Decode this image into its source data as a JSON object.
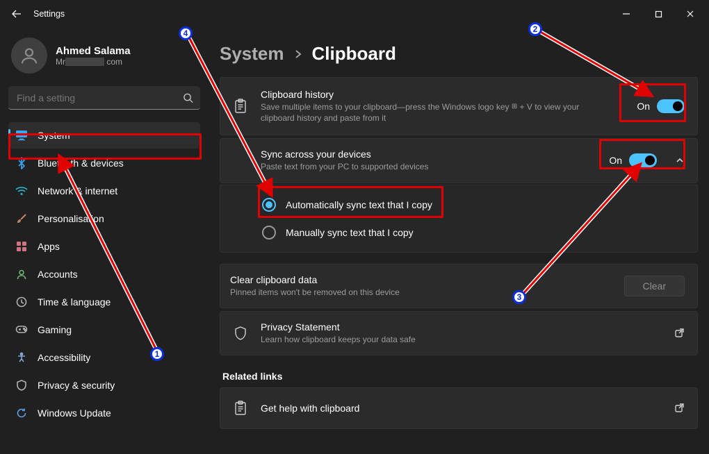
{
  "window": {
    "title": "Settings"
  },
  "profile": {
    "name": "Ahmed Salama",
    "email_prefix": "Mr",
    "email_suffix": "com"
  },
  "search": {
    "placeholder": "Find a setting"
  },
  "nav": {
    "items": [
      {
        "label": "System",
        "selected": true,
        "icon": "monitor",
        "color": "#3ba4f0"
      },
      {
        "label": "Bluetooth & devices",
        "icon": "bluetooth",
        "color": "#3ba4f0"
      },
      {
        "label": "Network & internet",
        "icon": "wifi",
        "color": "#25b1c4"
      },
      {
        "label": "Personalisation",
        "icon": "brush",
        "color": "#c7836a"
      },
      {
        "label": "Apps",
        "icon": "apps",
        "color": "#d17284"
      },
      {
        "label": "Accounts",
        "icon": "person",
        "color": "#6fb56f"
      },
      {
        "label": "Time & language",
        "icon": "clock",
        "color": "#b1b1b1"
      },
      {
        "label": "Gaming",
        "icon": "gaming",
        "color": "#b1b1b1"
      },
      {
        "label": "Accessibility",
        "icon": "accessibility",
        "color": "#80a8d0"
      },
      {
        "label": "Privacy & security",
        "icon": "shield",
        "color": "#b1b1b1"
      },
      {
        "label": "Windows Update",
        "icon": "sync",
        "color": "#5aa0e6"
      }
    ]
  },
  "breadcrumb": {
    "parent": "System",
    "current": "Clipboard"
  },
  "clipboard_history": {
    "title": "Clipboard history",
    "desc_pre": "Save multiple items to your clipboard—press the Windows logo key ",
    "desc_post": " + V to view your clipboard history and paste from it",
    "state": "On"
  },
  "sync": {
    "title": "Sync across your devices",
    "desc": "Paste text from your PC to supported devices",
    "state": "On",
    "option_auto": "Automatically sync text that I copy",
    "option_manual": "Manually sync text that I copy"
  },
  "clear": {
    "title": "Clear clipboard data",
    "desc": "Pinned items won't be removed on this device",
    "button": "Clear"
  },
  "privacy": {
    "title": "Privacy Statement",
    "desc": "Learn how clipboard keeps your data safe"
  },
  "related": {
    "heading": "Related links",
    "help": "Get help with clipboard"
  },
  "annotations": {
    "b1": "1",
    "b2": "2",
    "b3": "3",
    "b4": "4"
  }
}
